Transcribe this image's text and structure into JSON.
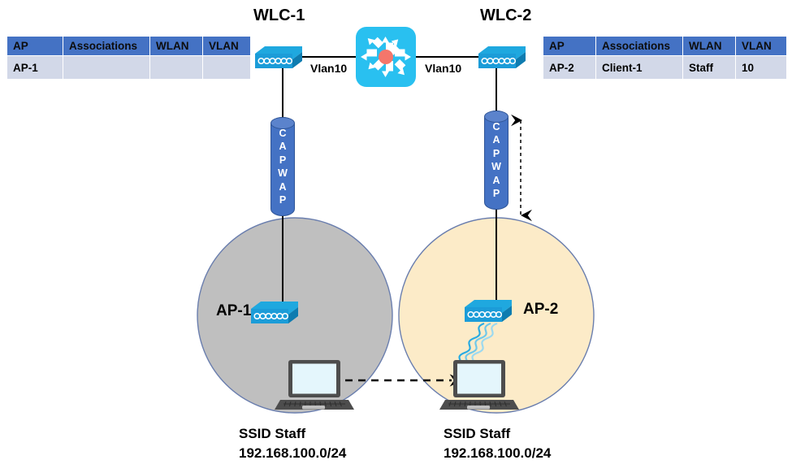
{
  "diagram": {
    "title": "WLC client roaming between AP-1 and AP-2",
    "colors": {
      "table_header": "#4472C4",
      "table_cell": "#D2D8E8",
      "capwap": "#4472C4",
      "ap_device": "#1B9CD8",
      "switch": "#29C0F0",
      "switch_center": "#F4766B",
      "coverage_left": "#BFBFBF",
      "coverage_right": "#FCEBC8",
      "coverage_border": "#6A7EAE",
      "wireless_signal": "#29ABE2",
      "laptop_body": "#4D4D4D",
      "laptop_screen": "#E4F6FC"
    }
  },
  "tables": {
    "left": {
      "name": "AP-1 association table",
      "columns": [
        "AP",
        "Associations",
        "WLAN",
        "VLAN"
      ],
      "rows": [
        {
          "ap": "AP-1",
          "associations": "",
          "wlan": "",
          "vlan": ""
        }
      ]
    },
    "right": {
      "name": "AP-2 association table",
      "columns": [
        "AP",
        "Associations",
        "WLAN",
        "VLAN"
      ],
      "rows": [
        {
          "ap": "AP-2",
          "associations": "Client-1",
          "wlan": "Staff",
          "vlan": "10"
        }
      ]
    }
  },
  "nodes": {
    "wlc1": {
      "label": "WLC-1",
      "icon": "wlc-controller-icon"
    },
    "wlc2": {
      "label": "WLC-2",
      "icon": "wlc-controller-icon"
    },
    "switch": {
      "icon": "multilayer-switch-icon"
    },
    "ap1": {
      "label": "AP-1",
      "icon": "access-point-icon"
    },
    "ap2": {
      "label": "AP-2",
      "icon": "access-point-icon"
    },
    "laptop1": {
      "icon": "laptop-icon"
    },
    "laptop2": {
      "icon": "laptop-icon"
    }
  },
  "links": {
    "vlan_left": "Vlan10",
    "vlan_right": "Vlan10",
    "capwap_left": {
      "letters": [
        "C",
        "A",
        "P",
        "W",
        "A",
        "P"
      ],
      "text": "CAPWAP"
    },
    "capwap_right": {
      "letters": [
        "C",
        "A",
        "P",
        "W",
        "A",
        "P"
      ],
      "text": "CAPWAP"
    }
  },
  "coverage": {
    "left": {
      "ssid": "SSID Staff",
      "subnet": "192.168.100.0/24"
    },
    "right": {
      "ssid": "SSID Staff",
      "subnet": "192.168.100.0/24"
    }
  }
}
